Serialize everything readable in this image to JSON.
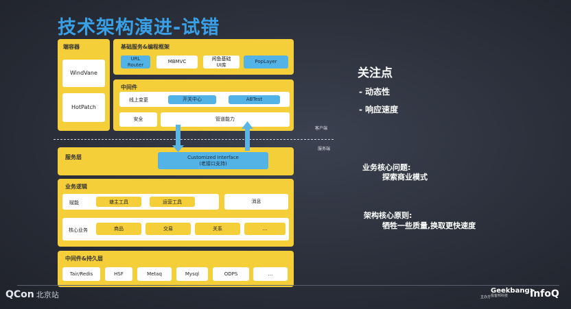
{
  "title": "技术架构演进-试错",
  "client": {
    "container_header": "端容器",
    "windvane": "WindVane",
    "hotpatch": "HotPatch",
    "basic_header": "基础服务&编程框架",
    "url_router": "URL\nRouter",
    "mbmvc": "MBMVC",
    "idle_ui": "闲鱼基础\nUI库",
    "poplayer": "PopLayer",
    "middleware_header": "中间件",
    "online_change": "线上变更",
    "switch_center": "开关中心",
    "abtest": "ABTest",
    "security": "安全",
    "pipeline": "管道能力",
    "client_tag": "客户端"
  },
  "server": {
    "server_tag": "服务端",
    "service_layer": "服务层",
    "customized_interface": "Customized Interface\n(老接口支持)",
    "biz_logic_header": "业务逻辑",
    "empower": "赋能",
    "shop_tools": "塘主工具",
    "ops_tools": "运营工具",
    "message": "消息",
    "core_biz": "核心业务",
    "goods": "商品",
    "trade": "交易",
    "relation": "关系",
    "more1": "...",
    "persist_header": "中间件&持久层",
    "tair": "Tair/Redis",
    "hsf": "HSF",
    "metaq": "Metaq",
    "mysql": "Mysql",
    "odps": "ODPS",
    "more2": "..."
  },
  "right": {
    "focus_title": "关注点",
    "focus_1": "- 动态性",
    "focus_2": "- 响应速度",
    "problem_title": "业务核心问题:",
    "problem_body": "探索商业模式",
    "principle_title": "架构核心原则:",
    "principle_body": "牺牲一些质量,换取更快速度"
  },
  "footer": {
    "left_logo": "QCon",
    "left_logo_sub": "北京站",
    "right_small": "主办方",
    "geekbang": "Geekbang>",
    "geekbang_sub": "极客邦科技",
    "infoq": "InfoQ"
  },
  "colors": {
    "accent_title": "#3aa0e6",
    "panel_yellow": "#f5cf3a",
    "chip_blue": "#53b3e6",
    "arrow_blue": "#5ab4e6"
  }
}
